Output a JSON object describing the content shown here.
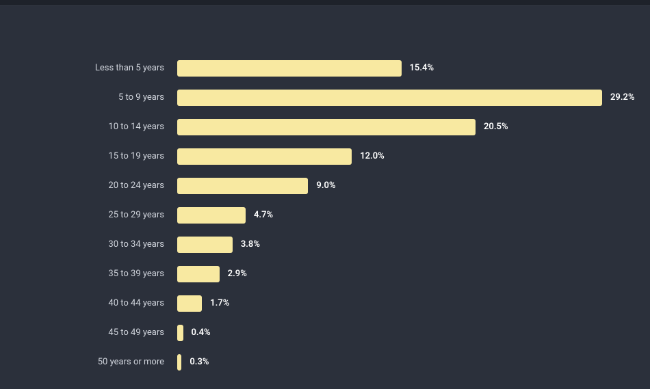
{
  "chart_data": {
    "type": "bar",
    "orientation": "horizontal",
    "categories": [
      "Less than 5 years",
      "5 to 9 years",
      "10 to 14 years",
      "15 to 19 years",
      "20 to 24 years",
      "25 to 29 years",
      "30 to 34 years",
      "35 to 39 years",
      "40 to 44 years",
      "45 to 49 years",
      "50 years or more"
    ],
    "values": [
      15.4,
      29.2,
      20.5,
      12.0,
      9.0,
      4.7,
      3.8,
      2.9,
      1.7,
      0.4,
      0.3
    ],
    "value_labels": [
      "15.4%",
      "29.2%",
      "20.5%",
      "12.0%",
      "9.0%",
      "4.7%",
      "3.8%",
      "2.9%",
      "1.7%",
      "0.4%",
      "0.3%"
    ],
    "unit": "%",
    "max_value": 29.2,
    "title": "",
    "xlabel": "",
    "ylabel": "",
    "colors": {
      "bar": "#f8e9a1",
      "background": "#2b303b",
      "text": "#d0d4dc",
      "value_text": "#ffffff"
    }
  }
}
